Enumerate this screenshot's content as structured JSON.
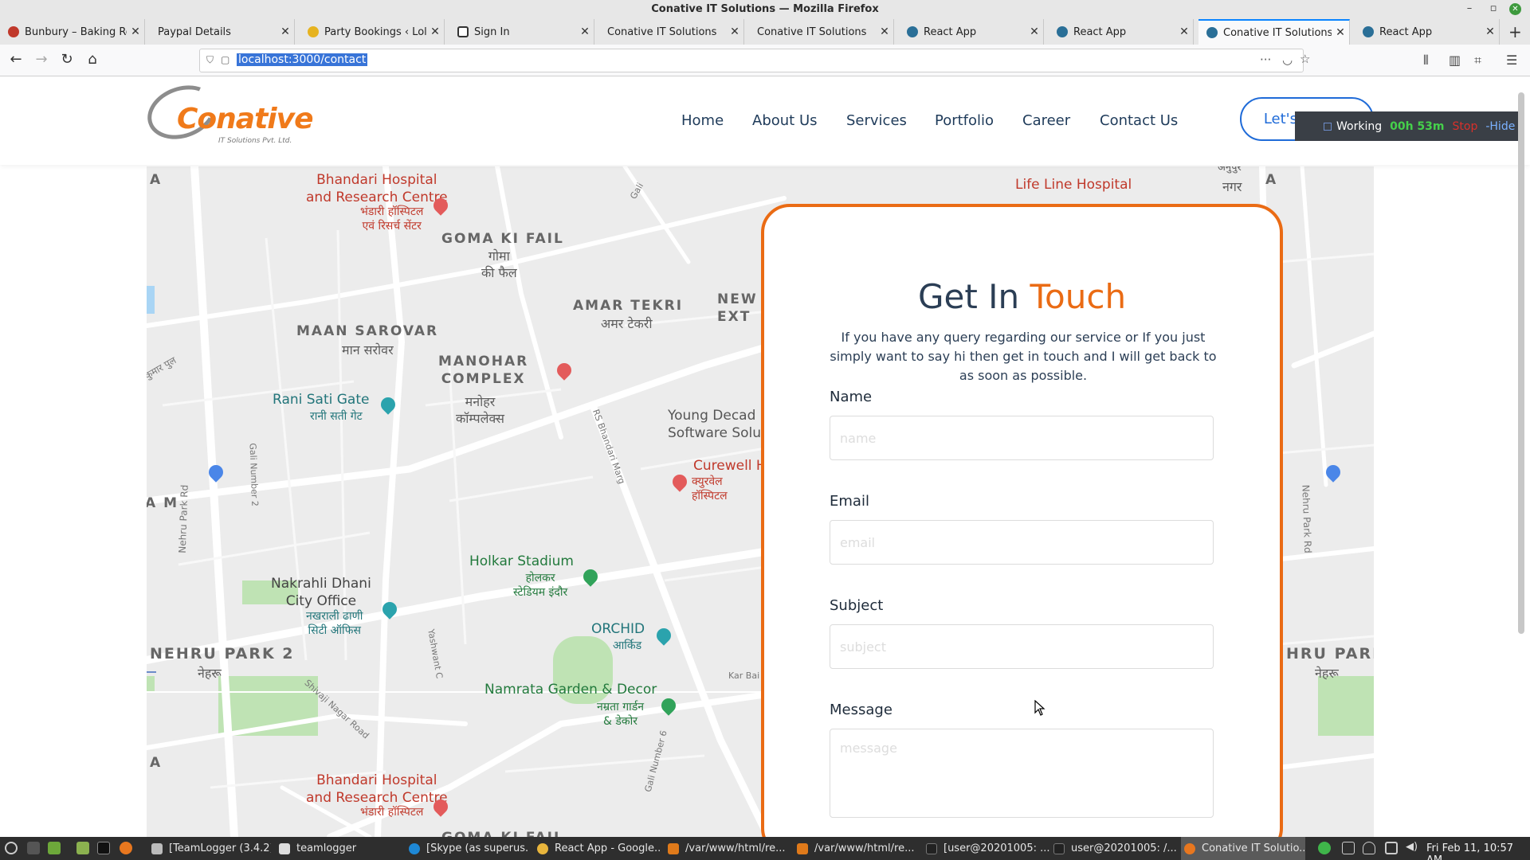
{
  "window": {
    "title": "Conative IT Solutions — Mozilla Firefox"
  },
  "tabs": [
    {
      "label": "Bunbury – Baking Ro",
      "fav_color": "#c0392b"
    },
    {
      "label": "Paypal Details",
      "fav_color": "#e7e7e7"
    },
    {
      "label": "Party Bookings ‹ Lolli",
      "fav_color": "#e6b320"
    },
    {
      "label": "Sign In",
      "fav_color": "#333333"
    },
    {
      "label": "Conative IT Solutions",
      "fav_color": "#e7e7e7"
    },
    {
      "label": "Conative IT Solutions",
      "fav_color": "#e7e7e7"
    },
    {
      "label": "React App",
      "fav_color": "#2a6f97"
    },
    {
      "label": "React App",
      "fav_color": "#2a6f97"
    },
    {
      "label": "Conative IT Solutions",
      "fav_color": "#2a6f97"
    },
    {
      "label": "React App",
      "fav_color": "#2a6f97"
    }
  ],
  "browser": {
    "url": "localhost:3000/contact"
  },
  "site": {
    "logo": {
      "name": "Conative",
      "tagline": "IT Solutions Pvt. Ltd."
    },
    "menu": [
      "Home",
      "About Us",
      "Services",
      "Portfolio",
      "Career",
      "Contact Us"
    ],
    "cta": "Let's Talk"
  },
  "map_labels": {
    "bhandari": "Bhandari Hospital\nand Research Centre",
    "bhandari_hi": "भंडारी हॉस्पिटल\nएवं रिसर्च सेंटर",
    "goma": "GOMA KI FAIL",
    "goma_hi": "गोमा\nकी फैल",
    "amar": "AMAR TEKRI",
    "amar_hi": "अमर टेकरी",
    "maan": "MAAN SAROVAR",
    "maan_hi": "मान सरोवर",
    "manohar": "MANOHAR\nCOMPLEX",
    "manohar_hi": "मनोहर\nकॉम्पलेक्स",
    "newext": "NEW\nEXT",
    "lifeline": "Life Line Hospital",
    "rani": "Rani Sati Gate",
    "rani_hi": "रानी सती गेट",
    "young": "Young Decad\nSoftware Solu",
    "curewell": "Curewell H",
    "curewell_hi": "क्युरवेल\nहॉस्पिटल",
    "holkar": "Holkar Stadium",
    "holkar_hi": "होलकर\nस्टेडियम इंदौर",
    "nakrahli": "Nakrahli Dhani\nCity Office",
    "nakrahli_hi": "नखराली ढाणी\nसिटी ऑफिस",
    "orchid": "ORCHID",
    "orchid_hi": "आर्किड",
    "nehru": "NEHRU PARK 2",
    "nehru_hi": "नेहरू",
    "nehru_right": "HRU PARK",
    "namrata": "Namrata Garden & Decor",
    "namrata_hi": "नम्रता गार्डन\n& डेकोर",
    "bhandari2": "Bhandari Hospital\nand Research Centre",
    "bhandari2_hi": "भंडारी हॉस्पिटल",
    "goma2": "GOMA KI FAIL",
    "nagar": "नगर",
    "anupur": "अनुपुर",
    "letter_a1": "A",
    "letter_a2": "A",
    "letter_a3": "A",
    "letter_am": "A M",
    "letter_a4": "A",
    "rs_bhandari": "RS Bhandari Marg",
    "nehru_rd": "Nehru Park Rd",
    "nehru_rd2": "Nehru Park Rd",
    "gali2": "Gali Number 2",
    "gali6": "Gali Number 6",
    "shivaji": "Shivaji Nagar Road",
    "yashwant": "Yashwant C",
    "kumar": "कुमार पुल",
    "kar_bai": "Kar Bai",
    "gali": "Gali"
  },
  "contact": {
    "title_plain": "Get In",
    "title_accent": "Touch",
    "intro": "If you have any query regarding our service or If you just simply want to say hi then get in touch and I will get back to as soon as possible.",
    "name_label": "Name",
    "name_placeholder": "name",
    "email_label": "Email",
    "email_placeholder": "email",
    "subject_label": "Subject",
    "subject_placeholder": "subject",
    "message_label": "Message",
    "message_placeholder": "message"
  },
  "tracker": {
    "status": "Working",
    "time": "00h 53m",
    "stop": "Stop",
    "hide": "-Hide"
  },
  "taskbar": {
    "items": [
      "[TeamLogger (3.4.2)]",
      "teamlogger",
      "[Skype (as superus...",
      "React App - Google...",
      "/var/www/html/re...",
      "/var/www/html/re...",
      "[user@20201005: ...",
      "user@20201005: /...",
      "Conative IT Solutio..."
    ],
    "clock": "Fri Feb 11, 10:57 AM"
  },
  "colors": {
    "accent": "#ea6b14",
    "brand_blue": "#1f6bd8",
    "heading": "#2b3e55"
  }
}
